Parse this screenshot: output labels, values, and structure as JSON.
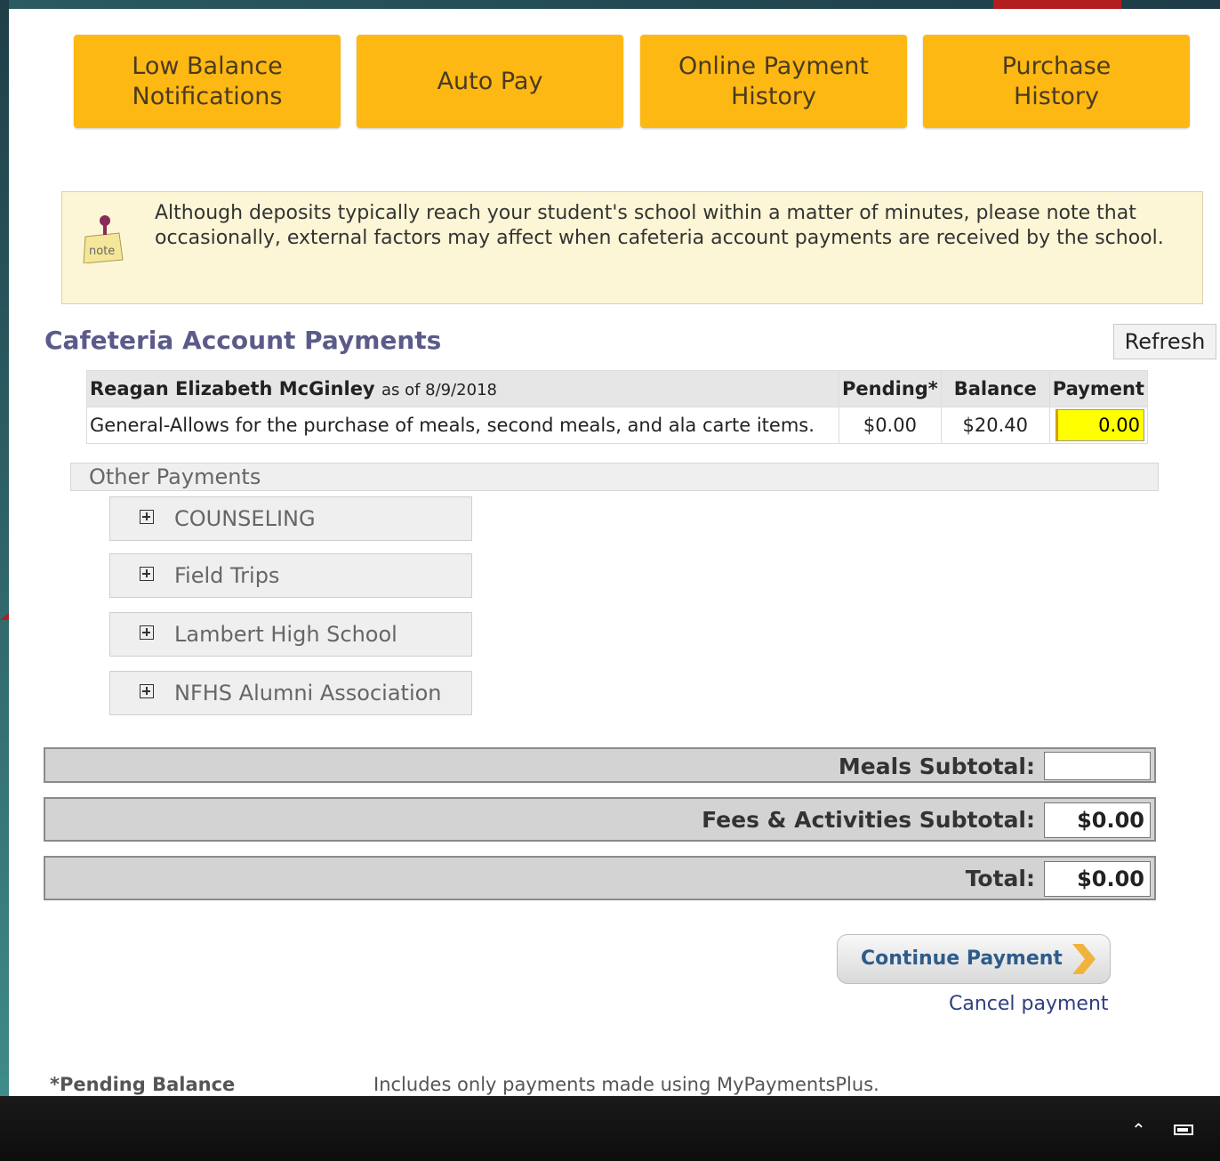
{
  "tiles": [
    {
      "label": "Low Balance\nNotifications"
    },
    {
      "label": "Auto Pay"
    },
    {
      "label": "Online Payment\nHistory"
    },
    {
      "label": "Purchase\nHistory"
    }
  ],
  "notice": {
    "icon": "note-icon",
    "text": "Although deposits typically reach your student's school within a matter of minutes, please note that occasionally, external factors may affect when cafeteria account payments are received by the school."
  },
  "section": {
    "title": "Cafeteria Account Payments",
    "refresh_label": "Refresh"
  },
  "account_table": {
    "student_name": "Reagan Elizabeth McGinley",
    "as_of": "as of 8/9/2018",
    "headers": {
      "pending": "Pending*",
      "balance": "Balance",
      "payment": "Payment"
    },
    "row": {
      "description": "General-Allows for the purchase of meals, second meals, and ala carte items.",
      "pending": "$0.00",
      "balance": "$20.40",
      "payment_value": "0.00"
    }
  },
  "other_payments": {
    "title": "Other Payments",
    "items": [
      {
        "label": "COUNSELING"
      },
      {
        "label": "Field Trips"
      },
      {
        "label": "Lambert High School"
      },
      {
        "label": "NFHS Alumni Association"
      }
    ]
  },
  "totals": {
    "meals_label": "Meals Subtotal:",
    "meals_value": "",
    "fees_label": "Fees & Activities Subtotal:",
    "fees_value": "$0.00",
    "total_label": "Total:",
    "total_value": "$0.00"
  },
  "actions": {
    "continue_label": "Continue Payment",
    "cancel_label": "Cancel payment"
  },
  "footer": {
    "label": "*Pending Balance",
    "text": "Includes only payments made using MyPaymentsPlus."
  },
  "colors": {
    "tile": "#fdb813",
    "title": "#5b5b8a",
    "payment_input": "#ffff00",
    "accent_red": "#b21e1e"
  }
}
